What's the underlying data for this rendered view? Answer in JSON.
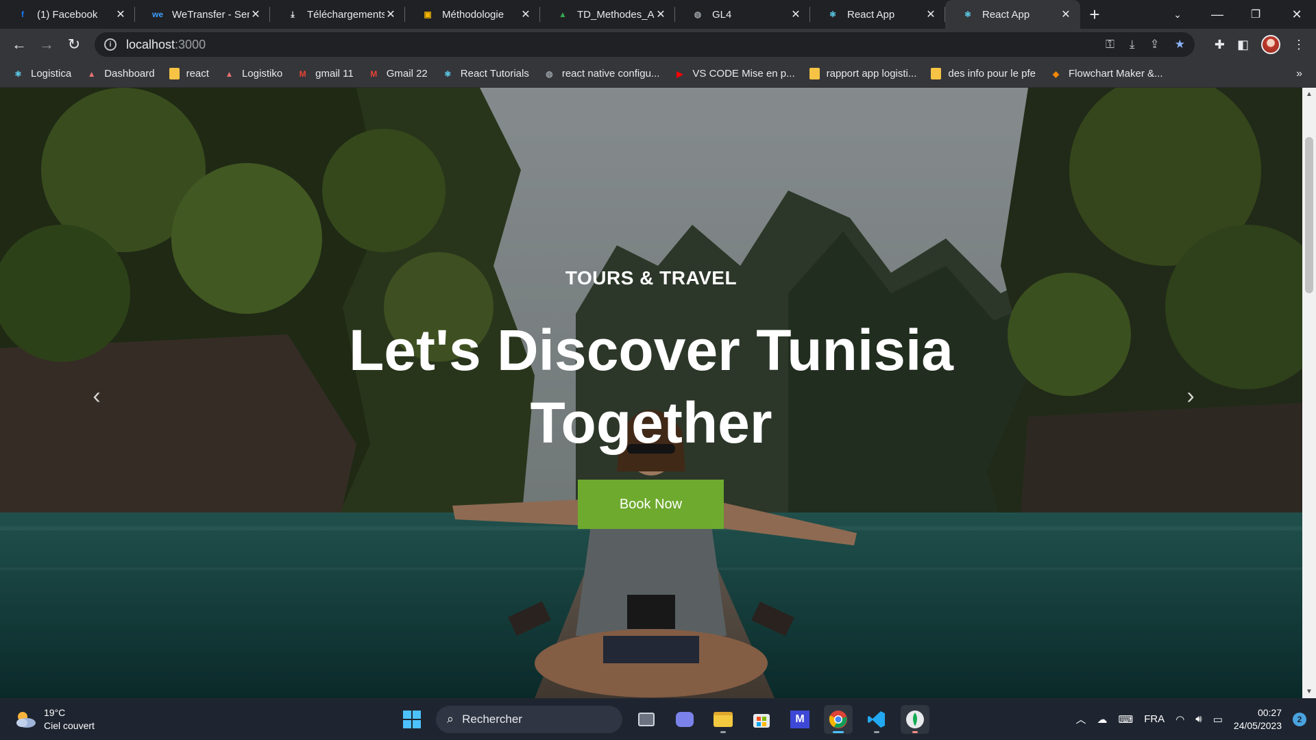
{
  "tabs": [
    {
      "title": "(1) Facebook",
      "icon": "facebook-icon",
      "color": "#1877f2",
      "glyph": "f"
    },
    {
      "title": "WeTransfer - Send",
      "icon": "wetransfer-icon",
      "color": "#409fff",
      "glyph": "we"
    },
    {
      "title": "Téléchargements",
      "icon": "download-icon",
      "color": "#e8eaed",
      "glyph": "⤓"
    },
    {
      "title": "Méthodologie",
      "icon": "slides-icon",
      "color": "#f4b400",
      "glyph": "▣"
    },
    {
      "title": "TD_Methodes_Agiles",
      "icon": "drive-icon",
      "color": "#34a853",
      "glyph": "▲"
    },
    {
      "title": "GL4",
      "icon": "globe-icon",
      "color": "#9aa0a6",
      "glyph": "◍"
    },
    {
      "title": "React App",
      "icon": "react-icon",
      "color": "#61dafb",
      "glyph": "⚛"
    },
    {
      "title": "React App",
      "icon": "react-icon",
      "color": "#61dafb",
      "glyph": "⚛",
      "active": true
    }
  ],
  "address": {
    "host": "localhost",
    "port": ":3000"
  },
  "bookmarks": [
    {
      "label": "Logistica",
      "icon": "react-icon",
      "color": "#61dafb",
      "glyph": "⚛"
    },
    {
      "label": "Dashboard",
      "icon": "site-icon",
      "color": "#e57373",
      "glyph": "▲"
    },
    {
      "label": "react",
      "icon": "folder-icon",
      "color": "#f6c344",
      "glyph": ""
    },
    {
      "label": "Logistiko",
      "icon": "site-icon",
      "color": "#e57373",
      "glyph": "▲"
    },
    {
      "label": "gmail 11",
      "icon": "gmail-icon",
      "color": "#ea4335",
      "glyph": "M"
    },
    {
      "label": "Gmail 22",
      "icon": "gmail-icon",
      "color": "#ea4335",
      "glyph": "M"
    },
    {
      "label": "React Tutorials",
      "icon": "react-icon",
      "color": "#61dafb",
      "glyph": "⚛"
    },
    {
      "label": "react native configu...",
      "icon": "globe-icon",
      "color": "#9aa0a6",
      "glyph": "◍"
    },
    {
      "label": "VS CODE Mise en p...",
      "icon": "youtube-icon",
      "color": "#ff0000",
      "glyph": "▶"
    },
    {
      "label": "rapport app logisti...",
      "icon": "folder-icon",
      "color": "#f6c344",
      "glyph": ""
    },
    {
      "label": "des info pour le pfe",
      "icon": "folder-icon",
      "color": "#f6c344",
      "glyph": ""
    },
    {
      "label": "Flowchart Maker &...",
      "icon": "drawio-icon",
      "color": "#f08705",
      "glyph": "◆"
    }
  ],
  "hero": {
    "subtitle": "TOURS & TRAVEL",
    "title_line1": "Let's Discover Tunisia",
    "title_line2": "Together",
    "button": "Book Now"
  },
  "taskbar": {
    "weather_temp": "19°C",
    "weather_desc": "Ciel couvert",
    "search_placeholder": "Rechercher",
    "language": "FRA",
    "time": "00:27",
    "date": "24/05/2023",
    "notifications": "2"
  },
  "colors": {
    "accent_button": "#6eaa2e",
    "chrome_dark": "#202124",
    "chrome_toolbar": "#35363a",
    "star": "#8ab4f8"
  }
}
